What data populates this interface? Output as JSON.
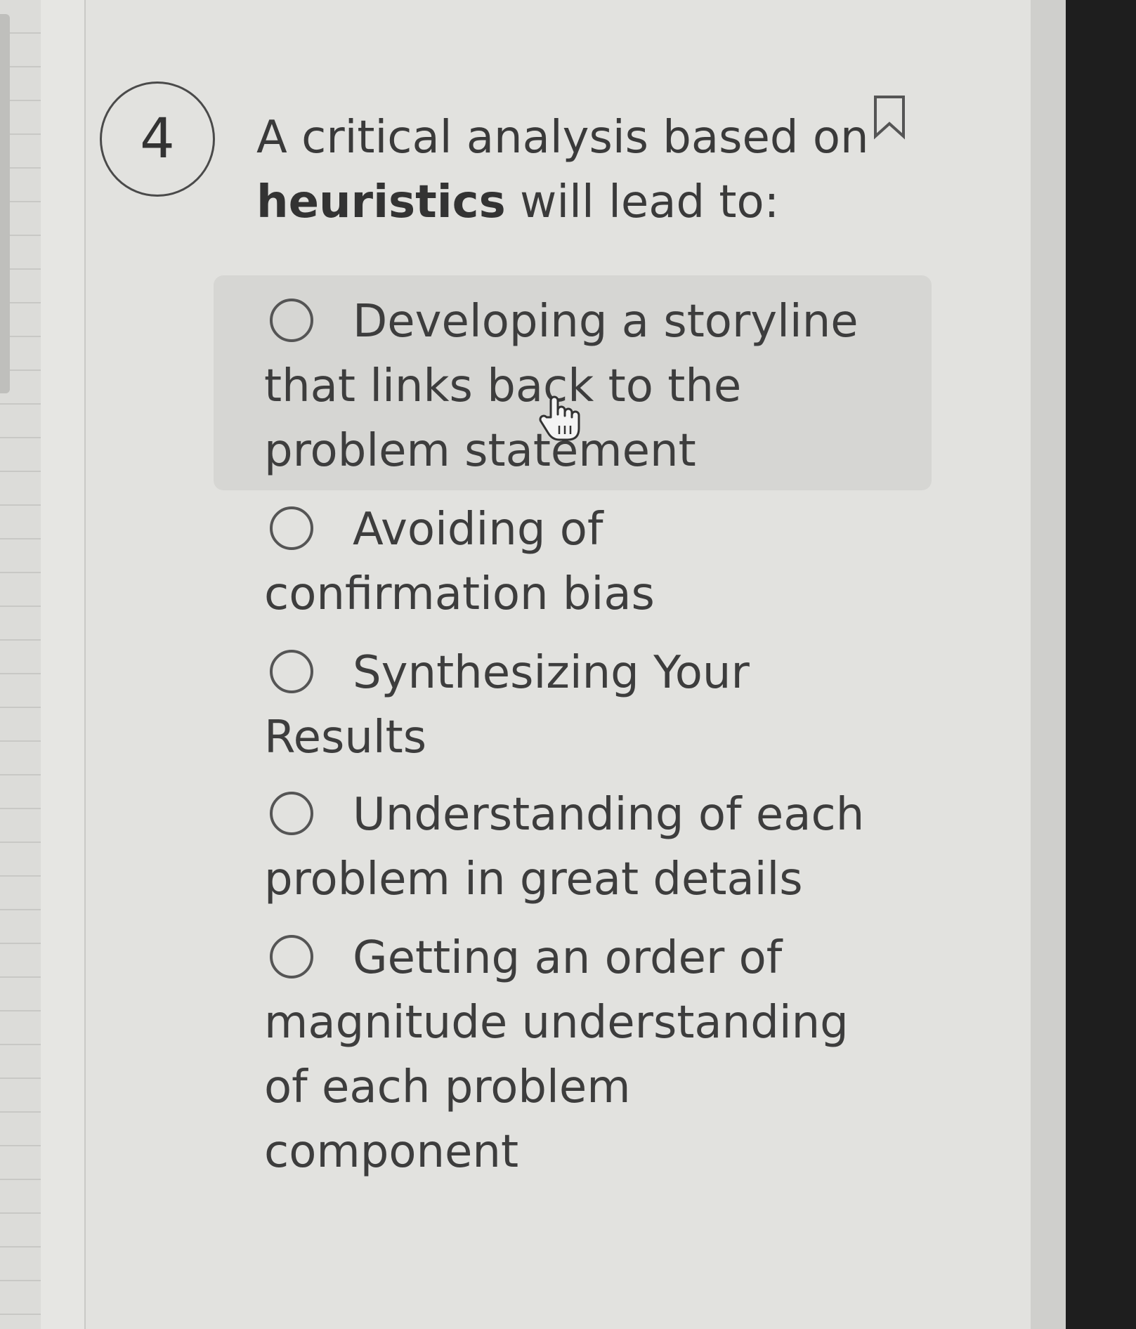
{
  "question": {
    "number": "4",
    "text_before": "A critical analysis based on ",
    "text_bold": "heuristics",
    "text_after": " will lead to:"
  },
  "options": [
    {
      "label": "Developing a storyline that links back to the problem statement"
    },
    {
      "label": "Avoiding of confirmation bias"
    },
    {
      "label": "Synthesizing Your Results"
    },
    {
      "label": "Understanding of each problem in great details"
    },
    {
      "label": "Getting an order of magnitude understanding of each problem component"
    }
  ],
  "icons": {
    "bookmark": "bookmark-icon",
    "cursor": "hand-pointer-icon",
    "radio": "radio-unchecked-icon"
  },
  "colors": {
    "card_background": "#e2e2df",
    "text": "#3d3d3d",
    "hover_highlight": "#d6d6d3",
    "bezel": "#1e1e1e"
  }
}
